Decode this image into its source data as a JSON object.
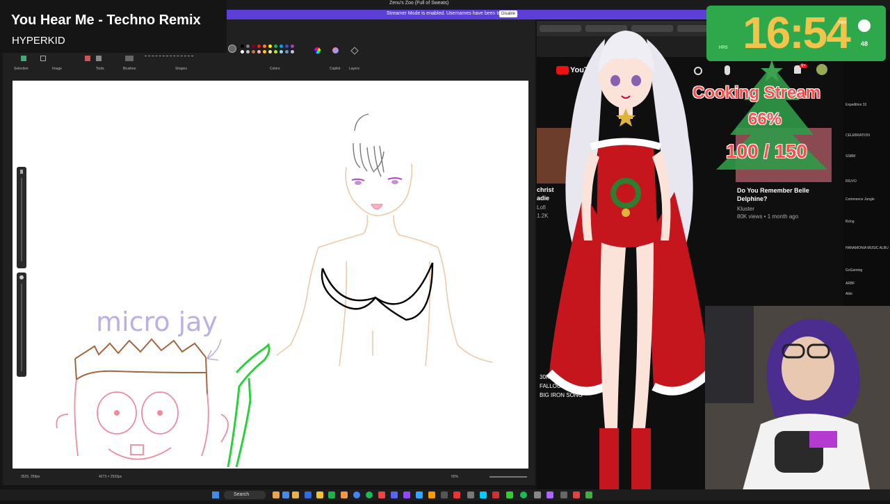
{
  "now_playing": {
    "song": "You Hear Me - Techno Remix",
    "artist": "HYPERKID"
  },
  "window_title": "Zenu's Zoo (Full of Sweats)",
  "streamer_mode": {
    "message": "Streamer Mode is enabled. Usernames have been truncated.",
    "disable_label": "Disable"
  },
  "paint": {
    "toolbar_groups": [
      "Selection",
      "Image",
      "Tools",
      "Brushes",
      "Shapes",
      "Colors",
      "Copilot",
      "Layers"
    ],
    "canvas_text": "micro jay",
    "status": {
      "cursor": "3525, 259px",
      "size": "4273 × 2533px",
      "zoom": "55%"
    },
    "palette": [
      "#000000",
      "#7f7f7f",
      "#880015",
      "#ed1c24",
      "#ff7f27",
      "#fff200",
      "#22b14c",
      "#00a2e8",
      "#3f48cc",
      "#a349a4",
      "#ffffff",
      "#c3c3c3",
      "#b97a57",
      "#ffaec9",
      "#ffc90e",
      "#efe4b0",
      "#b5e61d",
      "#99d9ea",
      "#7092be",
      "#c8bfe7"
    ]
  },
  "clock": {
    "time": "16:54",
    "min_label": "MIN",
    "hrs_label": "HRS",
    "seconds": "48"
  },
  "cooking_goal": {
    "title": "Cooking Stream",
    "percent": "66%",
    "progress": "100 / 150",
    "fraction": 0.66
  },
  "youtube": {
    "logo_text": "YouTube",
    "video_left": {
      "title_fragment": "christ",
      "line2": "adie",
      "line3": "Lofi",
      "views": "1.2K"
    },
    "video_right": {
      "title": "Do You Remember Belle Delphine?",
      "channel": "Kluster",
      "meta": "80K views • 1 month ago"
    },
    "bottom_video": {
      "views": "30K views",
      "title1": "FALLOUT SE",
      "title2": "BIG IRON SONG"
    }
  },
  "chat": [
    "Expedition 33",
    "CELEBRATION",
    "SSBM",
    "RIUVO",
    "Commence Jungle",
    "Bzlog",
    "HANAMONIA MUSIC ALBU",
    "GoGaming",
    "ARBF",
    "Aldo"
  ],
  "taskbar": {
    "search_label": "Search"
  },
  "colors": {
    "accent_purple": "#5b3fd6",
    "clock_green": "#2fa84b",
    "clock_yellow": "#f2c44b",
    "goal_red": "#ff4d4d"
  }
}
